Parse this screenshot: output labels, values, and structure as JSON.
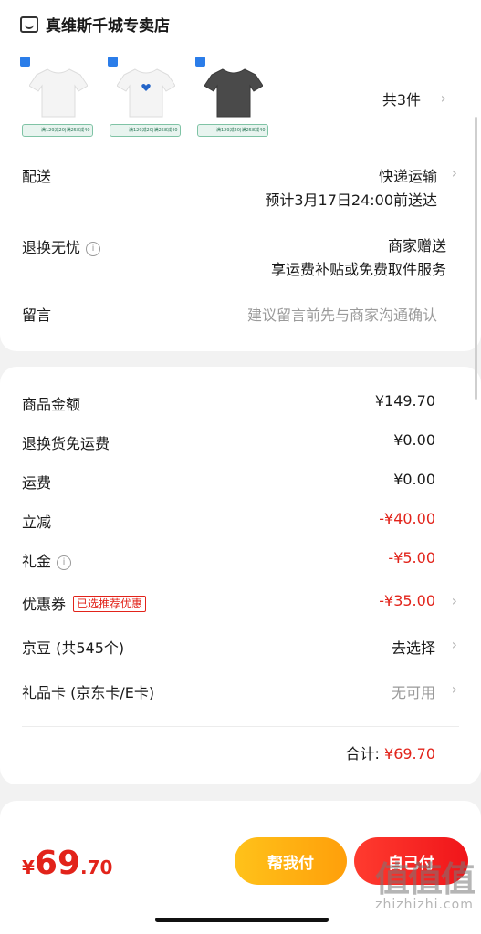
{
  "store": {
    "name": "真维斯千城专卖店",
    "icon": "shop-icon"
  },
  "products": {
    "items": [
      {
        "color": "white",
        "strip": "满129减20|满258减40"
      },
      {
        "color": "white-heart",
        "strip": "满129减20|满258减40"
      },
      {
        "color": "dark-gray",
        "strip": "满129减20|满258减40"
      }
    ],
    "count_label": "共3件"
  },
  "delivery": {
    "label": "配送",
    "method": "快递运输",
    "eta": "预计3月17日24:00前送达"
  },
  "returns": {
    "label": "退换无忧",
    "value": "商家赠送",
    "desc": "享运费补贴或免费取件服务"
  },
  "message": {
    "label": "留言",
    "placeholder": "建议留言前先与商家沟通确认"
  },
  "summary": {
    "goods_label": "商品金额",
    "goods_value": "¥149.70",
    "return_ship_label": "退换货免运费",
    "return_ship_value": "¥0.00",
    "ship_label": "运费",
    "ship_value": "¥0.00",
    "discount_label": "立减",
    "discount_value": "-¥40.00",
    "gift_label": "礼金",
    "gift_value": "-¥5.00",
    "coupon_label": "优惠券",
    "coupon_tag": "已选推荐优惠",
    "coupon_value": "-¥35.00",
    "jingdou_label": "京豆 (共545个)",
    "jingdou_value": "去选择",
    "giftcard_label": "礼品卡 (京东卡/E卡)",
    "giftcard_value": "无可用",
    "total_label": "合计:",
    "total_value": "¥69.70"
  },
  "footer": {
    "price_symbol": "¥",
    "price_int": "69",
    "price_dec": ".70",
    "help_pay": "帮我付",
    "self_pay": "自己付"
  },
  "watermark": {
    "logo": "值值值",
    "url": "zhizhizhi.com"
  },
  "colors": {
    "accent_red": "#e2231a",
    "help_btn": "#ffb212",
    "pay_btn": "#f0151a"
  }
}
